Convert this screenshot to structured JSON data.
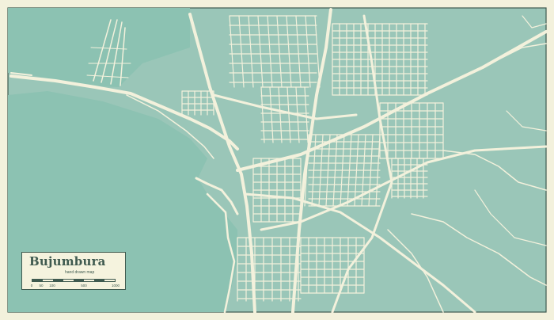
{
  "map": {
    "colors": {
      "background": "#f3f1dc",
      "water": "#8cc2b2",
      "land": "#9ac6b8",
      "roads": "#f3f1dc",
      "frame": "#3f5a4f"
    }
  },
  "legend": {
    "title": "Bujumbura",
    "subtitle": "hand drawn map",
    "scale_ticks": [
      "0",
      "50",
      "100",
      "500",
      "1000"
    ]
  }
}
